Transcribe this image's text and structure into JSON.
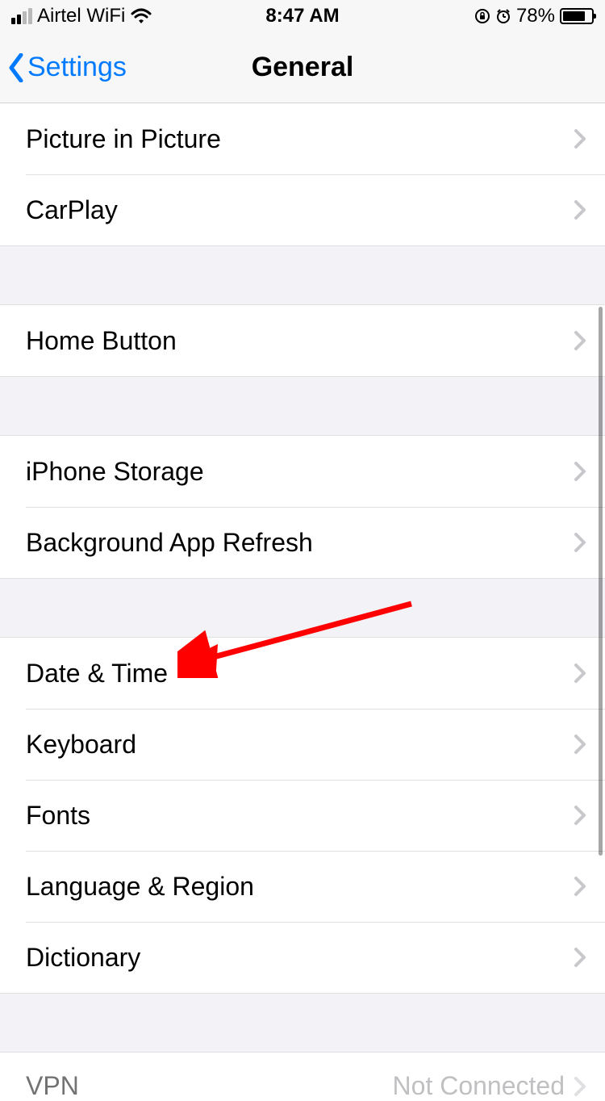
{
  "status_bar": {
    "carrier": "Airtel WiFi",
    "time": "8:47 AM",
    "battery_pct": "78%"
  },
  "nav": {
    "back_label": "Settings",
    "title": "General"
  },
  "groups": [
    {
      "rows": [
        {
          "label": "Picture in Picture",
          "detail": ""
        },
        {
          "label": "CarPlay",
          "detail": ""
        }
      ]
    },
    {
      "rows": [
        {
          "label": "Home Button",
          "detail": ""
        }
      ]
    },
    {
      "rows": [
        {
          "label": "iPhone Storage",
          "detail": ""
        },
        {
          "label": "Background App Refresh",
          "detail": ""
        }
      ]
    },
    {
      "rows": [
        {
          "label": "Date & Time",
          "detail": ""
        },
        {
          "label": "Keyboard",
          "detail": ""
        },
        {
          "label": "Fonts",
          "detail": ""
        },
        {
          "label": "Language & Region",
          "detail": ""
        },
        {
          "label": "Dictionary",
          "detail": ""
        }
      ]
    },
    {
      "rows": [
        {
          "label": "VPN",
          "detail": "Not Connected"
        }
      ]
    }
  ]
}
